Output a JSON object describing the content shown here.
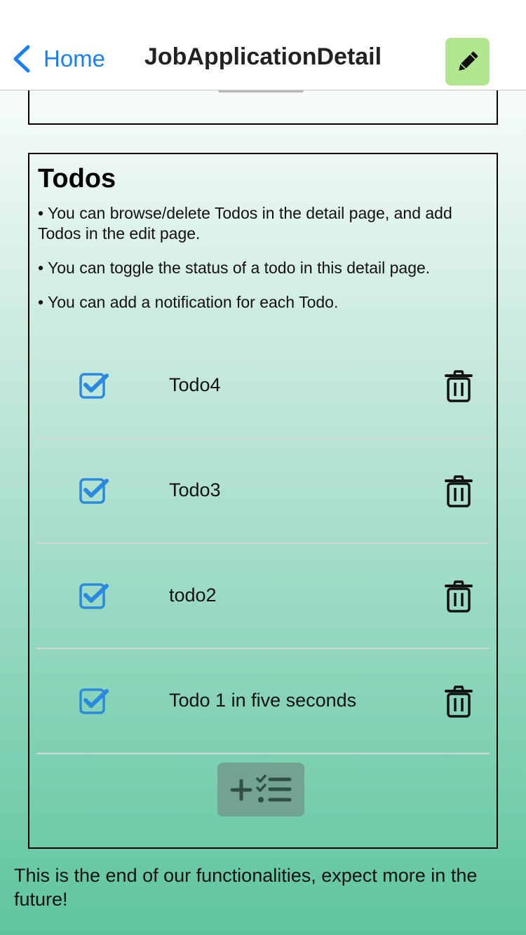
{
  "navbar": {
    "back_label": "Home",
    "title": "JobApplicationDetail",
    "edit_button_color": "#b2e68e",
    "accent_color": "#1a80f0"
  },
  "todos_section": {
    "title": "Todos",
    "notes": [
      "• You can browse/delete Todos in the detail page, and add Todos in the edit page.",
      "• You can toggle the status of a todo in this detail page.",
      "• You can add a notification for each Todo."
    ],
    "items": [
      {
        "label": "Todo4",
        "checked": true
      },
      {
        "label": "Todo3",
        "checked": true
      },
      {
        "label": "todo2",
        "checked": true
      },
      {
        "label": "Todo 1 in five seconds",
        "checked": true
      }
    ],
    "check_color": "#2b8ae0",
    "add_button_color": "#72a391"
  },
  "footer": {
    "text": "This is the end of our functionalities, expect more in the future!"
  }
}
